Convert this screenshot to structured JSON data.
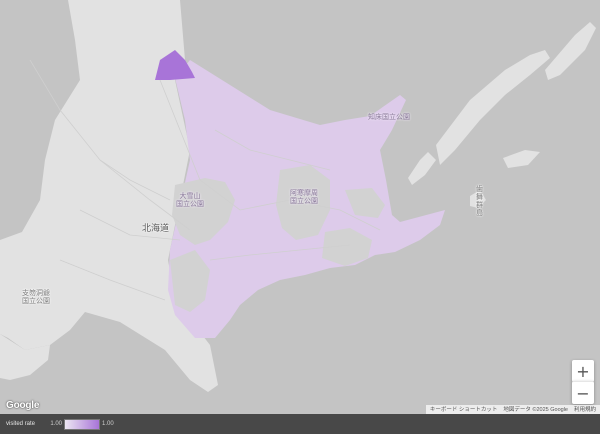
{
  "map": {
    "labels": {
      "hokkaido": "北海道",
      "daisetsuzan": "大雪山\n国立公園",
      "akan": "阿寒摩周\n国立公園",
      "shiretoko": "知床国立公園",
      "shikotsu": "支笏洞爺\n国立公園",
      "habomai": "歯\n舞\n群\n島"
    },
    "colors": {
      "sea": "#c4c4c4",
      "land": "#e2e2e2",
      "park": "#d2d2d2",
      "visited_light": "#ddcbea",
      "visited_strong": "#a874d8"
    }
  },
  "controls": {
    "zoom_in": "+",
    "zoom_out": "−",
    "zoom_in_icon": "plus-icon",
    "zoom_out_icon": "minus-icon"
  },
  "footer": {
    "google_logo": "Google",
    "shortcuts": "キーボード ショートカット",
    "map_data": "地図データ ©2025 Google",
    "terms": "利用規約"
  },
  "legend": {
    "title": "visited rate",
    "min": "1.00",
    "max": "1.00",
    "color_low": "#ece6f2",
    "color_high": "#a874d8"
  }
}
